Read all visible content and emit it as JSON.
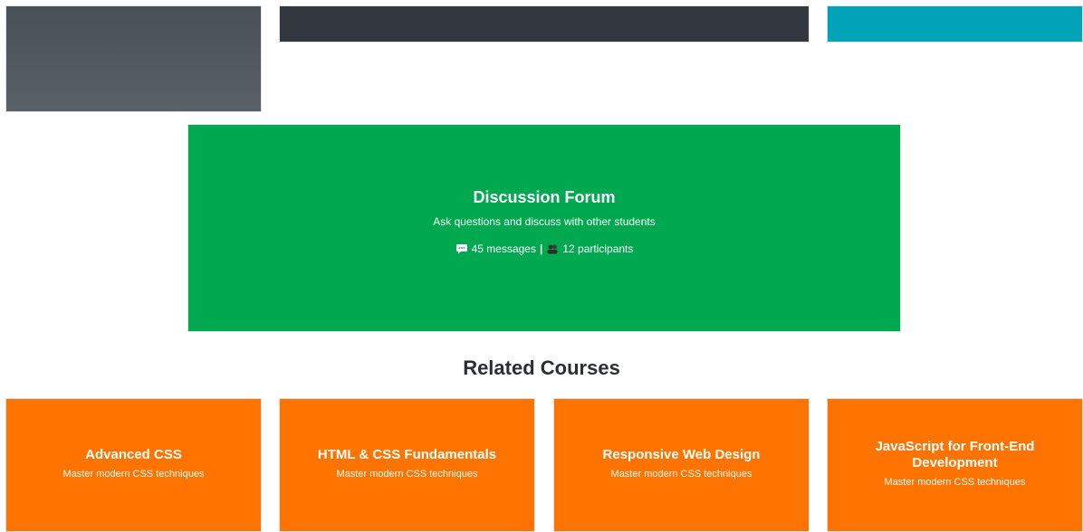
{
  "forum": {
    "title": "Discussion Forum",
    "description": "Ask questions and discuss with other students",
    "messages": "45 messages",
    "separator": "|",
    "participants": "12 participants",
    "background": "#00a84f"
  },
  "related": {
    "heading": "Related Courses",
    "courses": [
      {
        "title": "Advanced CSS",
        "description": "Master modern CSS techniques"
      },
      {
        "title": "HTML & CSS Fundamentals",
        "description": "Master modern CSS techniques"
      },
      {
        "title": "Responsive Web Design",
        "description": "Master modern CSS techniques"
      },
      {
        "title": "JavaScript for Front-End Development",
        "description": "Master modern CSS techniques"
      }
    ],
    "card_color": "#ff7300"
  },
  "top_tiles": {
    "colors": [
      "#4f555d",
      "#333840",
      "#00a3b8"
    ]
  },
  "icons": {
    "messages": "speech-bubble-icon",
    "participants": "people-icon"
  }
}
